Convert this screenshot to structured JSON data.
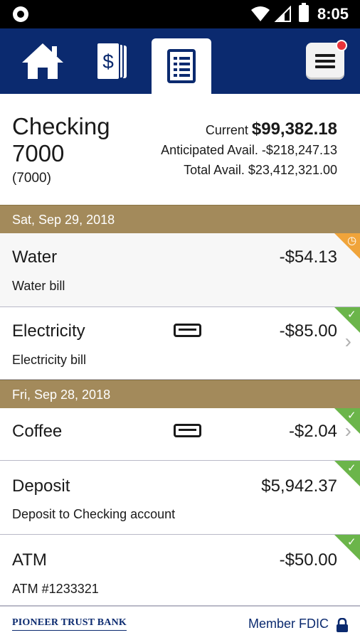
{
  "status_bar": {
    "time": "8:05"
  },
  "nav": {
    "items": [
      {
        "name": "home",
        "icon": "home-icon"
      },
      {
        "name": "money",
        "icon": "dollar-cards-icon"
      },
      {
        "name": "statements",
        "icon": "document-list-icon",
        "active": true
      }
    ],
    "menu_icon": "hamburger-menu-icon",
    "has_notification": true
  },
  "account": {
    "name": "Checking 7000",
    "number": "(7000)",
    "current_label": "Current",
    "current_value": "$99,382.18",
    "anticipated_label": "Anticipated Avail.",
    "anticipated_value": "-$218,247.13",
    "total_label": "Total Avail.",
    "total_value": "$23,412,321.00"
  },
  "groups": [
    {
      "date": "Sat, Sep 29, 2018",
      "transactions": [
        {
          "title": "Water",
          "description": "Water bill",
          "amount": "-$54.13",
          "status": "pending"
        },
        {
          "title": "Electricity",
          "description": "Electricity bill",
          "amount": "-$85.00",
          "status": "cleared",
          "card": true,
          "chevron": true
        }
      ]
    },
    {
      "date": "Fri, Sep 28, 2018",
      "transactions": [
        {
          "title": "Coffee",
          "description": "",
          "amount": "-$2.04",
          "status": "cleared",
          "card": true,
          "chevron": true
        },
        {
          "title": "Deposit",
          "description": "Deposit to Checking account",
          "amount": "$5,942.37",
          "status": "cleared"
        },
        {
          "title": "ATM",
          "description": "ATM #1233321",
          "amount": "-$50.00",
          "status": "cleared"
        }
      ]
    }
  ],
  "footer": {
    "bank_name": "PIONEER TRUST BANK",
    "member_fdic": "Member FDIC"
  },
  "colors": {
    "nav_bg": "#0b2a6f",
    "date_header_bg": "#a38a5b",
    "cleared": "#6bb54a",
    "pending": "#f0a43a",
    "notification": "#e8333a"
  }
}
